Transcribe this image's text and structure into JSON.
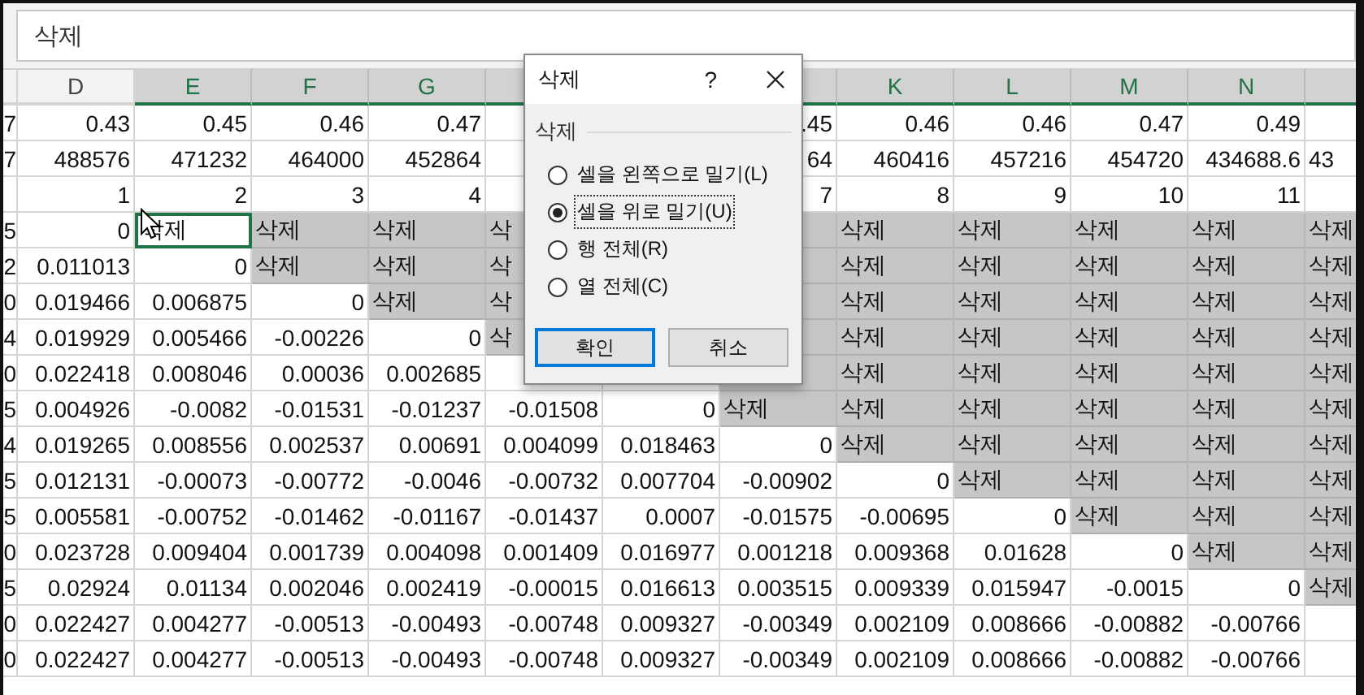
{
  "formula_bar": {
    "value": "삭제"
  },
  "columns": [
    {
      "label": "D",
      "selected": false
    },
    {
      "label": "E",
      "selected": true
    },
    {
      "label": "F",
      "selected": true
    },
    {
      "label": "G",
      "selected": true
    },
    {
      "selected": true
    },
    null,
    {
      "selected": true
    },
    {
      "label": "K",
      "selected": true
    },
    {
      "label": "L",
      "selected": true
    },
    {
      "label": "M",
      "selected": true
    },
    {
      "label": "N",
      "selected": true
    },
    {
      "selected": true
    }
  ],
  "rows": [
    {
      "stub": "7",
      "cells": [
        "0.43",
        "0.45",
        "0.46",
        "0.47",
        null,
        null,
        ".45",
        "0.46",
        "0.46",
        "0.47",
        "0.49",
        null
      ]
    },
    {
      "stub": "7",
      "cells": [
        "488576",
        "471232",
        "464000",
        "452864",
        null,
        null,
        "64",
        "460416",
        "457216",
        "454720",
        "434688.6",
        "43"
      ]
    },
    {
      "cells": [
        "1",
        "2",
        "3",
        "4",
        null,
        null,
        "7",
        "8",
        "9",
        "10",
        "11",
        null
      ]
    },
    {
      "stub": "5",
      "cells": [
        "0",
        {
          "text": "삭제",
          "active": true
        },
        {
          "text": "삭제",
          "selected": true
        },
        {
          "text": "삭제",
          "selected": true
        },
        {
          "text": "삭",
          "selected": true
        },
        null,
        {
          "selected": true
        },
        {
          "text": "삭제",
          "selected": true
        },
        {
          "text": "삭제",
          "selected": true
        },
        {
          "text": "삭제",
          "selected": true
        },
        {
          "text": "삭제",
          "selected": true
        },
        {
          "text": "삭제",
          "selected": true
        }
      ]
    },
    {
      "stub": "2",
      "cells": [
        "0.011013",
        "0",
        {
          "text": "삭제",
          "selected": true
        },
        {
          "text": "삭제",
          "selected": true
        },
        {
          "text": "삭",
          "selected": true
        },
        null,
        {
          "selected": true
        },
        {
          "text": "삭제",
          "selected": true
        },
        {
          "text": "삭제",
          "selected": true
        },
        {
          "text": "삭제",
          "selected": true
        },
        {
          "text": "삭제",
          "selected": true
        },
        {
          "text": "삭제",
          "selected": true
        }
      ]
    },
    {
      "stub": "0",
      "cells": [
        "0.019466",
        "0.006875",
        "0",
        {
          "text": "삭제",
          "selected": true
        },
        {
          "text": "삭",
          "selected": true
        },
        null,
        {
          "selected": true
        },
        {
          "text": "삭제",
          "selected": true
        },
        {
          "text": "삭제",
          "selected": true
        },
        {
          "text": "삭제",
          "selected": true
        },
        {
          "text": "삭제",
          "selected": true
        },
        {
          "text": "삭제",
          "selected": true
        }
      ]
    },
    {
      "stub": "4",
      "cells": [
        "0.019929",
        "0.005466",
        "-0.00226",
        "0",
        {
          "text": "삭",
          "selected": true
        },
        null,
        {
          "selected": true
        },
        {
          "text": "삭제",
          "selected": true
        },
        {
          "text": "삭제",
          "selected": true
        },
        {
          "text": "삭제",
          "selected": true
        },
        {
          "text": "삭제",
          "selected": true
        },
        {
          "text": "삭제",
          "selected": true
        }
      ]
    },
    {
      "stub": "0",
      "cells": [
        "0.022418",
        "0.008046",
        "0.00036",
        "0.002685",
        null,
        null,
        {
          "selected": true
        },
        {
          "text": "삭제",
          "selected": true
        },
        {
          "text": "삭제",
          "selected": true
        },
        {
          "text": "삭제",
          "selected": true
        },
        {
          "text": "삭제",
          "selected": true
        },
        {
          "text": "삭제",
          "selected": true
        }
      ]
    },
    {
      "stub": "5",
      "cells": [
        "0.004926",
        "-0.0082",
        "-0.01531",
        "-0.01237",
        "-0.01508",
        "0",
        {
          "text": "삭제",
          "selected": true
        },
        {
          "text": "삭제",
          "selected": true
        },
        {
          "text": "삭제",
          "selected": true
        },
        {
          "text": "삭제",
          "selected": true
        },
        {
          "text": "삭제",
          "selected": true
        },
        {
          "text": "삭제",
          "selected": true
        }
      ]
    },
    {
      "stub": "4",
      "cells": [
        "0.019265",
        "0.008556",
        "0.002537",
        "0.00691",
        "0.004099",
        "0.018463",
        "0",
        {
          "text": "삭제",
          "selected": true
        },
        {
          "text": "삭제",
          "selected": true
        },
        {
          "text": "삭제",
          "selected": true
        },
        {
          "text": "삭제",
          "selected": true
        },
        {
          "text": "삭제",
          "selected": true
        }
      ]
    },
    {
      "stub": "5",
      "cells": [
        "0.012131",
        "-0.00073",
        "-0.00772",
        "-0.0046",
        "-0.00732",
        "0.007704",
        "-0.00902",
        "0",
        {
          "text": "삭제",
          "selected": true
        },
        {
          "text": "삭제",
          "selected": true
        },
        {
          "text": "삭제",
          "selected": true
        },
        {
          "text": "삭제",
          "selected": true
        }
      ]
    },
    {
      "stub": "5",
      "cells": [
        "0.005581",
        "-0.00752",
        "-0.01462",
        "-0.01167",
        "-0.01437",
        "0.0007",
        "-0.01575",
        "-0.00695",
        "0",
        {
          "text": "삭제",
          "selected": true
        },
        {
          "text": "삭제",
          "selected": true
        },
        {
          "text": "삭제",
          "selected": true
        }
      ]
    },
    {
      "stub": "0",
      "cells": [
        "0.023728",
        "0.009404",
        "0.001739",
        "0.004098",
        "0.001409",
        "0.016977",
        "0.001218",
        "0.009368",
        "0.01628",
        "0",
        {
          "text": "삭제",
          "selected": true
        },
        {
          "text": "삭제",
          "selected": true
        }
      ]
    },
    {
      "stub": "5",
      "cells": [
        "0.02924",
        "0.01134",
        "0.002046",
        "0.002419",
        "-0.00015",
        "0.016613",
        "0.003515",
        "0.009339",
        "0.015947",
        "-0.0015",
        "0",
        {
          "text": "삭제",
          "selected": true
        }
      ]
    },
    {
      "stub": "0",
      "cells": [
        "0.022427",
        "0.004277",
        "-0.00513",
        "-0.00493",
        "-0.00748",
        "0.009327",
        "-0.00349",
        "0.002109",
        "0.008666",
        "-0.00882",
        "-0.00766",
        null
      ]
    },
    {
      "stub": "0",
      "cells": [
        "0.022427",
        "0.004277",
        "-0.00513",
        "-0.00493",
        "-0.00748",
        "0.009327",
        "-0.00349",
        "0.002109",
        "0.008666",
        "-0.00882",
        "-0.00766",
        null
      ]
    }
  ],
  "dialog": {
    "title": "삭제",
    "help": "?",
    "group_label": "삭제",
    "options": [
      {
        "label": "셀을 왼쪽으로 밀기(L)",
        "selected": false
      },
      {
        "label": "셀을 위로 밀기(U)",
        "selected": true
      },
      {
        "label": "행 전체(R)",
        "selected": false
      },
      {
        "label": "열 전체(C)",
        "selected": false
      }
    ],
    "buttons": [
      {
        "label": "확인",
        "default": true
      },
      {
        "label": "취소",
        "default": false
      }
    ]
  }
}
